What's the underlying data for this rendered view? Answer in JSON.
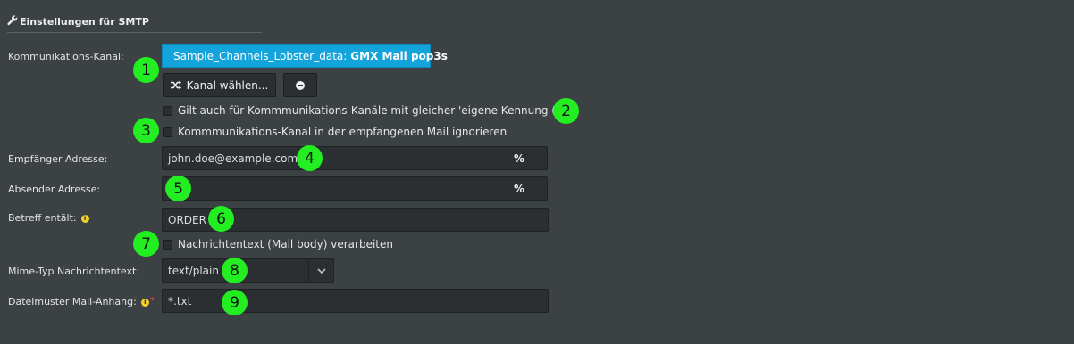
{
  "section": {
    "title": "Einstellungen für SMTP",
    "icon": "wrench-icon"
  },
  "fields": {
    "channel": {
      "label": "Kommunikations-Kanal:",
      "prefix": "Sample_Channels_Lobster_data:",
      "name": "GMX Mail pop3s",
      "choose_button": "Kanal wählen...",
      "remove_icon": "minus-circle-icon"
    },
    "checkbox_same_id": {
      "label": "Gilt auch für Kommmunikations-Kanäle mit gleicher 'eigene Kennung (ich)'",
      "checked": false
    },
    "checkbox_ignore_channel": {
      "label": "Kommmunikations-Kanal in der empfangenen Mail ignorieren",
      "checked": false
    },
    "recipient": {
      "label": "Empfänger Adresse:",
      "value": "john.doe@example.com",
      "button": "%"
    },
    "sender": {
      "label": "Absender Adresse:",
      "value": "",
      "button": "%"
    },
    "subject": {
      "label": "Betreff entält:",
      "value": "ORDER",
      "info_icon": "info-icon"
    },
    "checkbox_body": {
      "label": "Nachrichtentext (Mail body) verarbeiten",
      "checked": false
    },
    "mime": {
      "label": "Mime-Typ Nachrichtentext:",
      "value": "text/plain"
    },
    "attachment": {
      "label": "Dateimuster Mail-Anhang:",
      "value": "*.txt",
      "required": "*"
    }
  },
  "markers": [
    "1",
    "2",
    "3",
    "4",
    "5",
    "6",
    "7",
    "8",
    "9"
  ],
  "colors": {
    "accent": "#14a4dc",
    "marker": "#22ee22",
    "background": "#3c4143"
  }
}
